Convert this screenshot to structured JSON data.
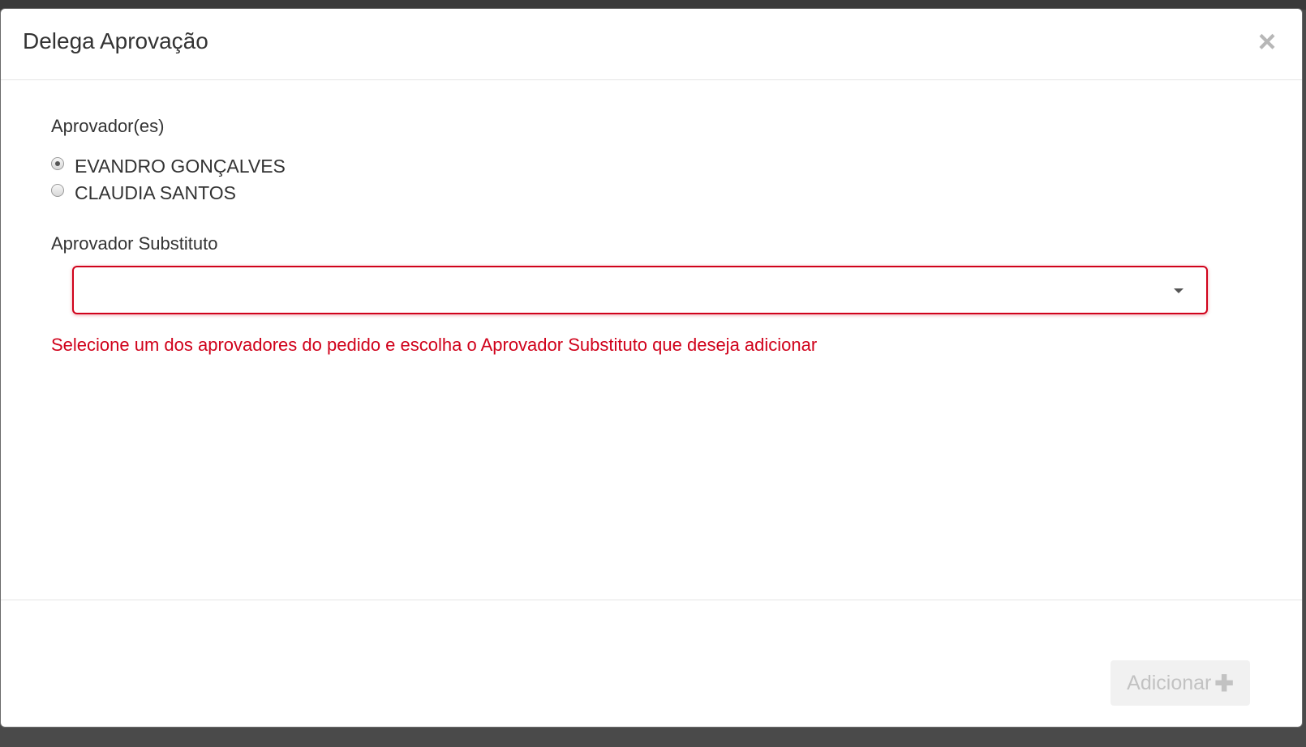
{
  "modal": {
    "title": "Delega Aprovação",
    "close_icon": "×"
  },
  "approvers": {
    "label": "Aprovador(es)",
    "options": [
      {
        "label": "EVANDRO GONÇALVES",
        "checked": true
      },
      {
        "label": "CLAUDIA SANTOS",
        "checked": false
      }
    ]
  },
  "substitute": {
    "label": "Aprovador Substituto",
    "value": ""
  },
  "error": {
    "message": "Selecione um dos aprovadores do pedido e escolha o Aprovador Substituto que deseja adicionar",
    "color": "#d0021b"
  },
  "footer": {
    "add_label": "Adicionar",
    "add_icon": "✚"
  }
}
